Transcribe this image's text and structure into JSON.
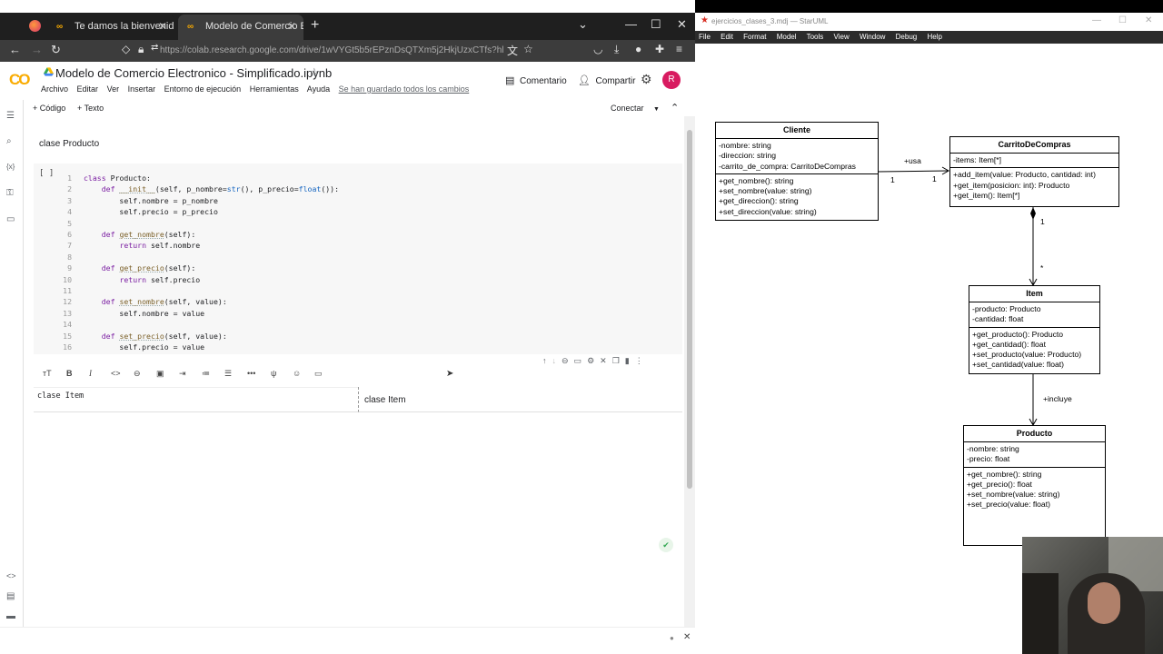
{
  "browser": {
    "tabs": [
      {
        "label": "Te damos la bienvenida a Colab",
        "icon": "colab-icon"
      },
      {
        "label": "Modelo de Comercio Electroni...",
        "icon": "colab-icon"
      }
    ],
    "url": "https://colab.research.google.com/drive/1wVYGt5b5rEPznDsQTXm5j2HkjUzxCTfs?hl=es#scrollTo"
  },
  "colab": {
    "logo": "CO",
    "notebook_title": "Modelo de Comercio Electronico - Simplificado.ipynb",
    "menu": [
      "Archivo",
      "Editar",
      "Ver",
      "Insertar",
      "Entorno de ejecución",
      "Herramientas",
      "Ayuda"
    ],
    "saved_status": "Se han guardado todos los cambios",
    "comment_label": "Comentario",
    "share_label": "Compartir",
    "avatar_letter": "R",
    "add_code_label": "+ Código",
    "add_text_label": "+ Texto",
    "connect_label": "Conectar",
    "text_cell_1": "clase Producto",
    "run_indicator": "[ ]",
    "md_source": "clase Item",
    "md_rendered": "clase Item"
  },
  "code_lines": [
    {
      "n": "1",
      "text": "class Producto:"
    },
    {
      "n": "2",
      "text": "    def __init__(self, p_nombre=str(), p_precio=float()):"
    },
    {
      "n": "3",
      "text": "        self.nombre = p_nombre"
    },
    {
      "n": "4",
      "text": "        self.precio = p_precio"
    },
    {
      "n": "5",
      "text": ""
    },
    {
      "n": "6",
      "text": "    def get_nombre(self):"
    },
    {
      "n": "7",
      "text": "        return self.nombre"
    },
    {
      "n": "8",
      "text": ""
    },
    {
      "n": "9",
      "text": "    def get_precio(self):"
    },
    {
      "n": "10",
      "text": "        return self.precio"
    },
    {
      "n": "11",
      "text": ""
    },
    {
      "n": "12",
      "text": "    def set_nombre(self, value):"
    },
    {
      "n": "13",
      "text": "        self.nombre = value"
    },
    {
      "n": "14",
      "text": ""
    },
    {
      "n": "15",
      "text": "    def set_precio(self, value):"
    },
    {
      "n": "16",
      "text": "        self.precio = value"
    }
  ],
  "staruml": {
    "title": "ejercicios_clases_3.mdj — StarUML",
    "menu": [
      "File",
      "Edit",
      "Format",
      "Model",
      "Tools",
      "View",
      "Window",
      "Debug",
      "Help"
    ],
    "classes": {
      "cliente": {
        "name": "Cliente",
        "attributes": [
          "-nombre: string",
          "-direccion: string",
          "-carrito_de_compra: CarritoDeCompras"
        ],
        "operations": [
          "+get_nombre(): string",
          "+set_nombre(value: string)",
          "+get_direccion(): string",
          "+set_direccion(value: string)"
        ]
      },
      "carrito": {
        "name": "CarritoDeCompras",
        "attributes": [
          "-items: Item[*]"
        ],
        "operations": [
          "+add_item(value: Producto, cantidad: int)",
          "+get_item(posicion: int): Producto",
          "+get_item(): Item[*]"
        ]
      },
      "item": {
        "name": "Item",
        "attributes": [
          "-producto: Producto",
          "-cantidad: float"
        ],
        "operations": [
          "+get_producto(): Producto",
          "+get_cantidad(): float",
          "+set_producto(value: Producto)",
          "+set_cantidad(value: float)"
        ]
      },
      "producto": {
        "name": "Producto",
        "attributes": [
          "-nombre: string",
          "-precio: float"
        ],
        "operations": [
          "+get_nombre(): string",
          "+get_precio(): float",
          "+set_nombre(value: string)",
          "+set_precio(value: float)"
        ]
      }
    },
    "labels": {
      "usa": "+usa",
      "mult_cliente": "1",
      "mult_carrito": "1",
      "mult_comp_one": "1",
      "mult_comp_many": "*",
      "incluye": "+incluye"
    }
  }
}
